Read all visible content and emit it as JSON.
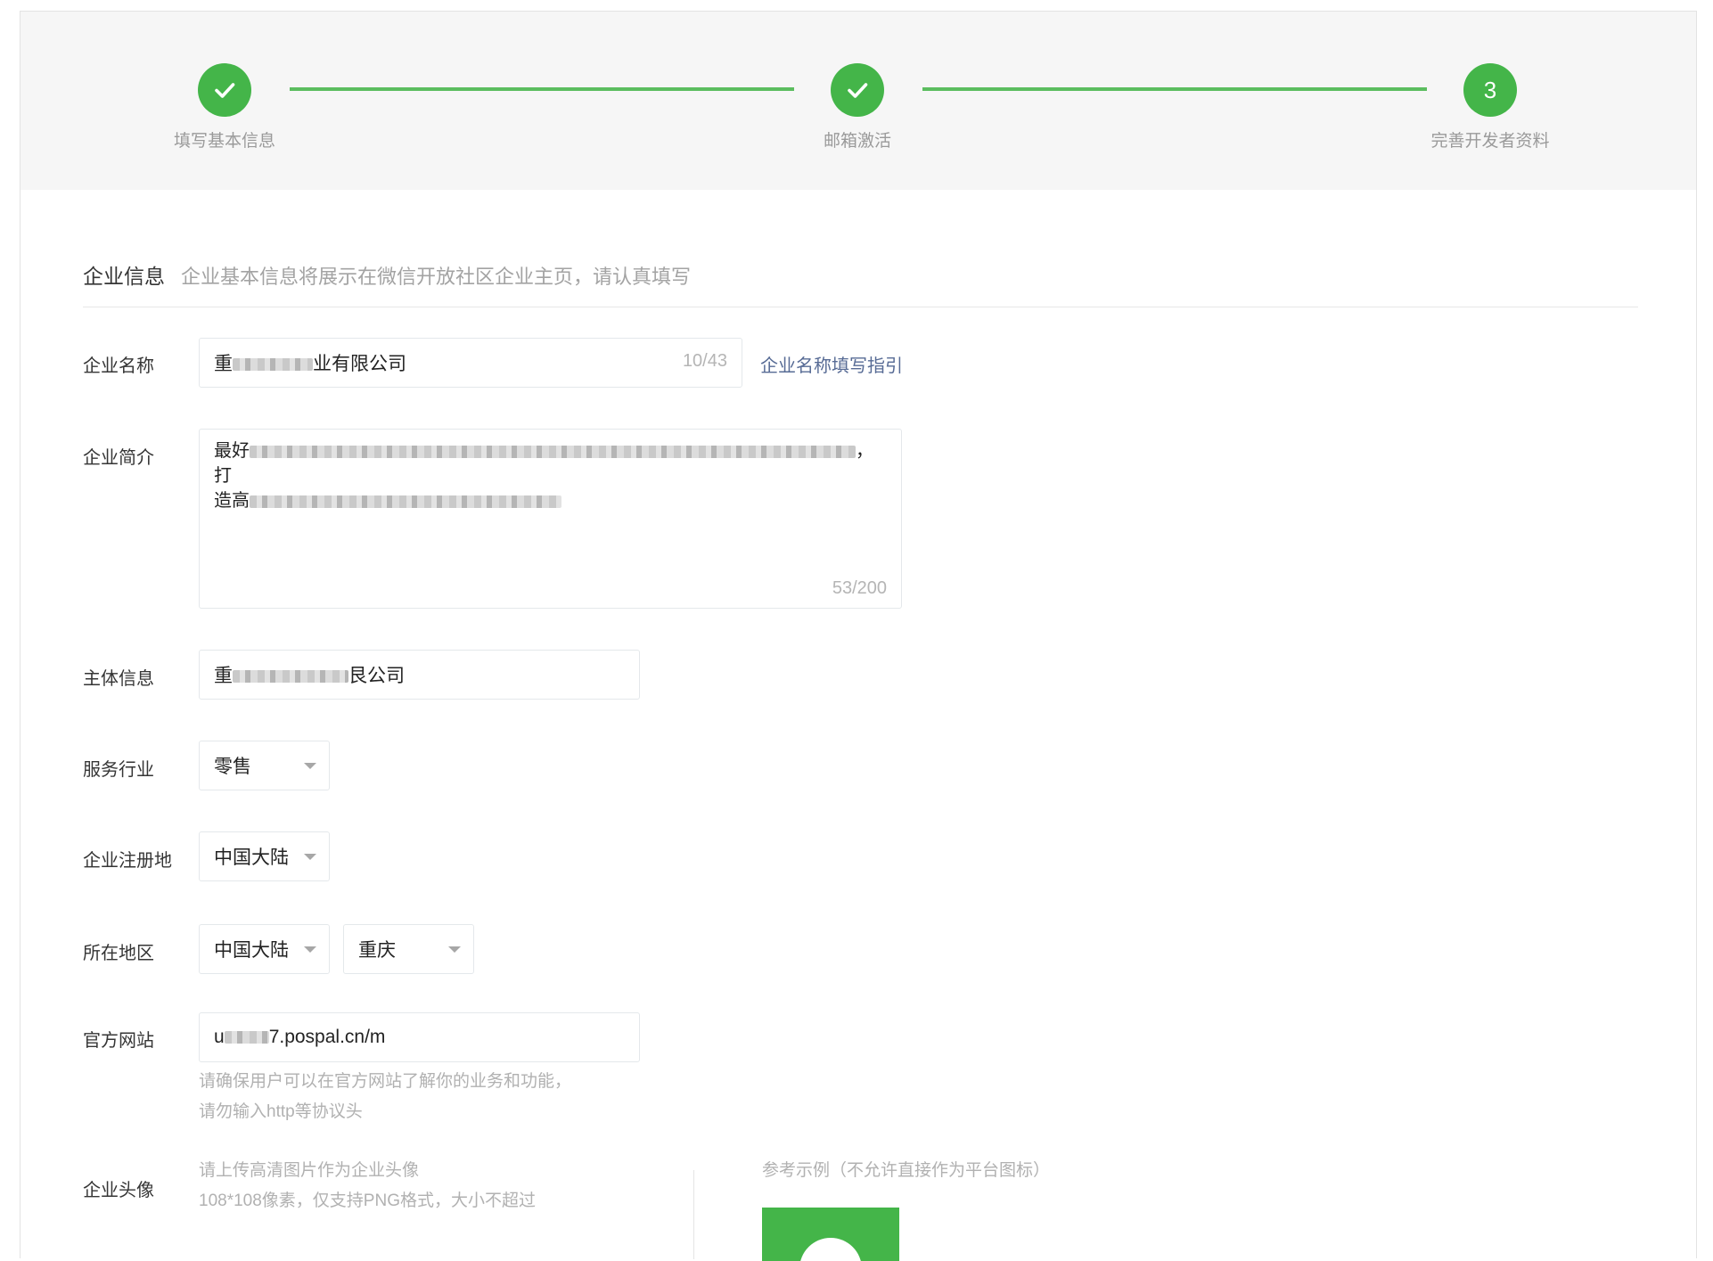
{
  "stepper": {
    "steps": [
      {
        "label": "填写基本信息",
        "state": "done"
      },
      {
        "label": "邮箱激活",
        "state": "done"
      },
      {
        "label": "完善开发者资料",
        "state": "current",
        "number": "3"
      }
    ],
    "accent_color": "#44b549"
  },
  "section": {
    "title": "企业信息",
    "description": "企业基本信息将展示在微信开放社区企业主页，请认真填写"
  },
  "form": {
    "company_name": {
      "label": "企业名称",
      "value_prefix": "重",
      "value_suffix": "业有限公司",
      "counter": "10/43",
      "guide_link": "企业名称填写指引"
    },
    "intro": {
      "label": "企业简介",
      "line1_prefix": "最好",
      "line1_suffix": "，打",
      "line2_prefix": "造高",
      "counter": "53/200"
    },
    "entity": {
      "label": "主体信息",
      "value_prefix": "重",
      "value_suffix": "艮公司"
    },
    "industry": {
      "label": "服务行业",
      "value": "零售"
    },
    "reg_place": {
      "label": "企业注册地",
      "value": "中国大陆"
    },
    "region": {
      "label": "所在地区",
      "country": "中国大陆",
      "city": "重庆"
    },
    "website": {
      "label": "官方网站",
      "value_prefix": "u",
      "value_suffix": "7.pospal.cn/m",
      "hint_line1": "请确保用户可以在官方网站了解你的业务和功能，",
      "hint_line2": "请勿输入http等协议头"
    },
    "avatar": {
      "label": "企业头像",
      "hint_line1": "请上传高清图片作为企业头像",
      "hint_line2": "108*108像素，仅支持PNG格式，大小不超过",
      "example_label": "参考示例（不允许直接作为平台图标）"
    }
  }
}
